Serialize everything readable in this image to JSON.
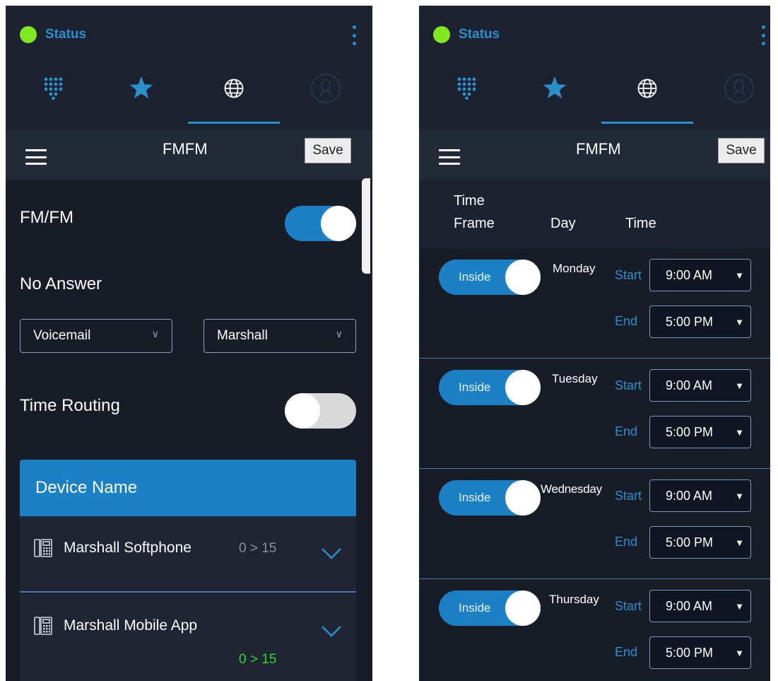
{
  "status": {
    "label": "Status",
    "color": "#7fe81f"
  },
  "header": {
    "title": "FMFM",
    "save_label": "Save"
  },
  "tabs": [
    {
      "name": "dialpad",
      "active": false
    },
    {
      "name": "favorites",
      "active": false
    },
    {
      "name": "globe",
      "active": true
    },
    {
      "name": "contacts",
      "active": false
    }
  ],
  "settings": {
    "fmfm_label": "FM/FM",
    "fmfm_on": true,
    "no_answer_label": "No Answer",
    "no_answer_action": "Voicemail",
    "no_answer_target": "Marshall",
    "time_routing_label": "Time Routing",
    "time_routing_on": false
  },
  "devices": {
    "header": "Device Name",
    "items": [
      {
        "name": "Marshall Softphone",
        "range": "0 > 15",
        "range_color": "#8c919c"
      },
      {
        "name": "Marshall Mobile App",
        "range": "0 > 15",
        "range_color": "#2fd82a"
      }
    ]
  },
  "schedule": {
    "columns": {
      "time_frame_line1": "Time",
      "time_frame_line2": "Frame",
      "day": "Day",
      "time": "Time"
    },
    "start_label": "Start",
    "end_label": "End",
    "days": [
      {
        "toggle": "Inside",
        "day": "Monday",
        "start": "9:00 AM",
        "end": "5:00 PM"
      },
      {
        "toggle": "Inside",
        "day": "Tuesday",
        "start": "9:00 AM",
        "end": "5:00 PM"
      },
      {
        "toggle": "Inside",
        "day": "Wednesday",
        "start": "9:00 AM",
        "end": "5:00 PM"
      },
      {
        "toggle": "Inside",
        "day": "Thursday",
        "start": "9:00 AM",
        "end": "5:00 PM"
      }
    ]
  },
  "colors": {
    "accent": "#2a8fcd",
    "panel": "#171c27",
    "device_header": "#1b80c4"
  }
}
